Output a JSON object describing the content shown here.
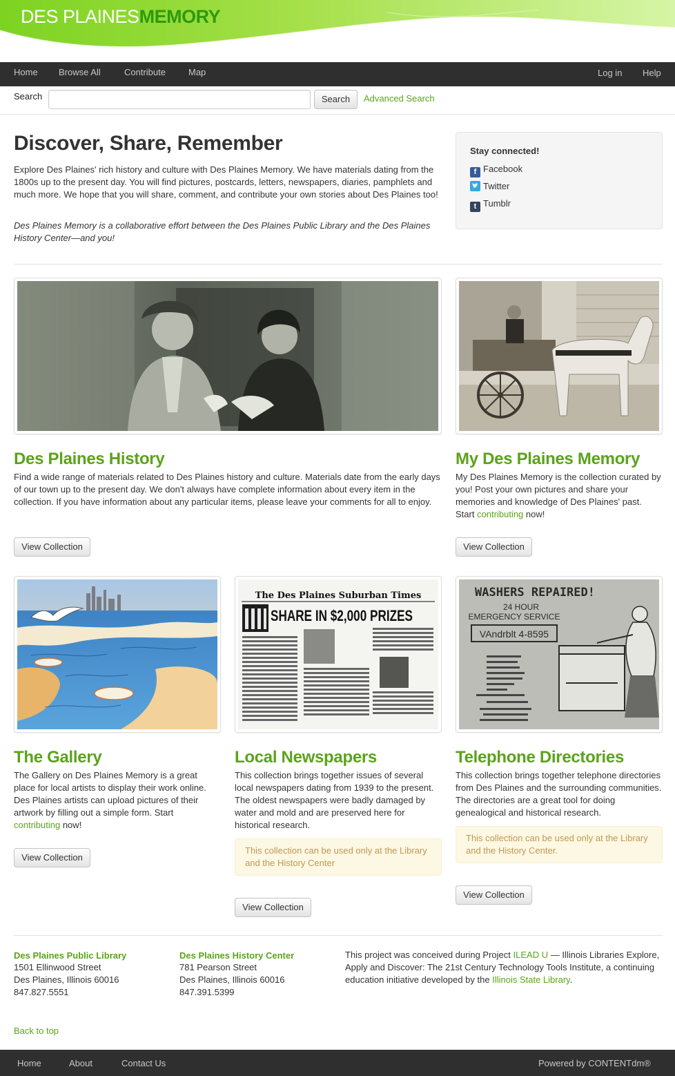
{
  "header": {
    "logo_part1": "DES PLAINES",
    "logo_part2": "MEMORY"
  },
  "nav": {
    "left": [
      "Home",
      "Browse All",
      "Contribute",
      "Map"
    ],
    "right": [
      "Log in",
      "Help"
    ]
  },
  "search": {
    "label": "Search",
    "value": "",
    "placeholder": "",
    "button": "Search",
    "advanced": "Advanced Search"
  },
  "hero": {
    "title": "Discover, Share, Remember",
    "paragraph1": "Explore Des Plaines' rich history and culture with Des Plaines Memory. We have materials dating from the 1800s up to the present day. You will find pictures, postcards, letters, newspapers, diaries, pamphlets and much more. We hope that you will share, comment, and contribute your own stories about Des Plaines too!",
    "paragraph2": "Des Plaines Memory is a collaborative effort between the Des Plaines Public Library and the Des Plaines History Center—and you!"
  },
  "stay_connected": {
    "title": "Stay connected!",
    "links": [
      {
        "label": "Facebook",
        "icon": "facebook-icon",
        "color": "#3b5998"
      },
      {
        "label": "Twitter",
        "icon": "twitter-icon",
        "color": "#33a9e0"
      },
      {
        "label": "Tumblr",
        "icon": "tumblr-icon",
        "color": "#35465c"
      }
    ]
  },
  "collections": {
    "history": {
      "title": "Des Plaines History",
      "description": "Find a wide range of materials related to Des Plaines history and culture. Materials date from the early days of our town up to the present day. We don't always have complete information about every item in the collection. If you have information about any particular items, please leave your comments for all to enjoy.",
      "button": "View Collection"
    },
    "my_memory": {
      "title": "My Des Plaines Memory",
      "description_before": "My Des Plaines Memory is the collection curated by you! Post your own pictures and share your memories and knowledge of Des Plaines' past. Start ",
      "link": "contributing",
      "description_after": " now!",
      "button": "View Collection"
    },
    "gallery": {
      "title": "The Gallery",
      "description_before": "The Gallery on Des Plaines Memory is a great place for local artists to display their work online. Des Plaines artists can upload pictures of their artwork by filling out a simple form. Start ",
      "link": "contributing",
      "description_after": " now!",
      "button": "View Collection"
    },
    "newspapers": {
      "title": "Local Newspapers",
      "description": "This collection brings together issues of several local newspapers dating from 1939 to the present. The oldest newspapers were badly damaged by water and mold and are preserved here for historical research.",
      "notice": "This collection can be used only at the Library and the History Center",
      "button": "View Collection",
      "image_text": {
        "masthead": "The Des Plaines Suburban Times",
        "headline": "SHARE IN $2,000 PRIZES"
      }
    },
    "directories": {
      "title": "Telephone Directories",
      "description": "This collection brings together telephone directories from Des Plaines and the surrounding communities. The directories are a great tool for doing genealogical and historical research.",
      "notice": "This collection can be used only at the Library and the History Center.",
      "button": "View Collection",
      "image_text": {
        "headline": "WASHERS REPAIRED!",
        "line1": "24 HOUR",
        "line2": "EMERGENCY SERVICE",
        "phone": "VAndrblt 4-8595"
      }
    }
  },
  "footer": {
    "library": {
      "name": "Des Plaines Public Library",
      "street": "1501 Ellinwood Street",
      "city": "Des Plaines, Illinois 60016",
      "phone": "847.827.5551"
    },
    "history_center": {
      "name": "Des Plaines History Center",
      "street": "781 Pearson Street",
      "city": "Des Plaines, Illinois 60016",
      "phone": "847.391.5399"
    },
    "project": {
      "text_before": "This project was conceived during Project ",
      "link1": "ILEAD U",
      "text_middle": " — Illinois Libraries Explore, Apply and Discover: The 21st Century Technology Tools Institute, a continuing education initiative developed by the ",
      "link2": "Illinois State Library",
      "text_after": "."
    },
    "back_to_top": "Back to top",
    "bar_links": [
      "Home",
      "About",
      "Contact Us"
    ],
    "powered_by": "Powered by CONTENTdm®"
  },
  "colors": {
    "accent": "#5ba31a",
    "navbar": "#2f2f2f",
    "notice_bg": "#fcf8e3",
    "notice_text": "#c09853"
  }
}
